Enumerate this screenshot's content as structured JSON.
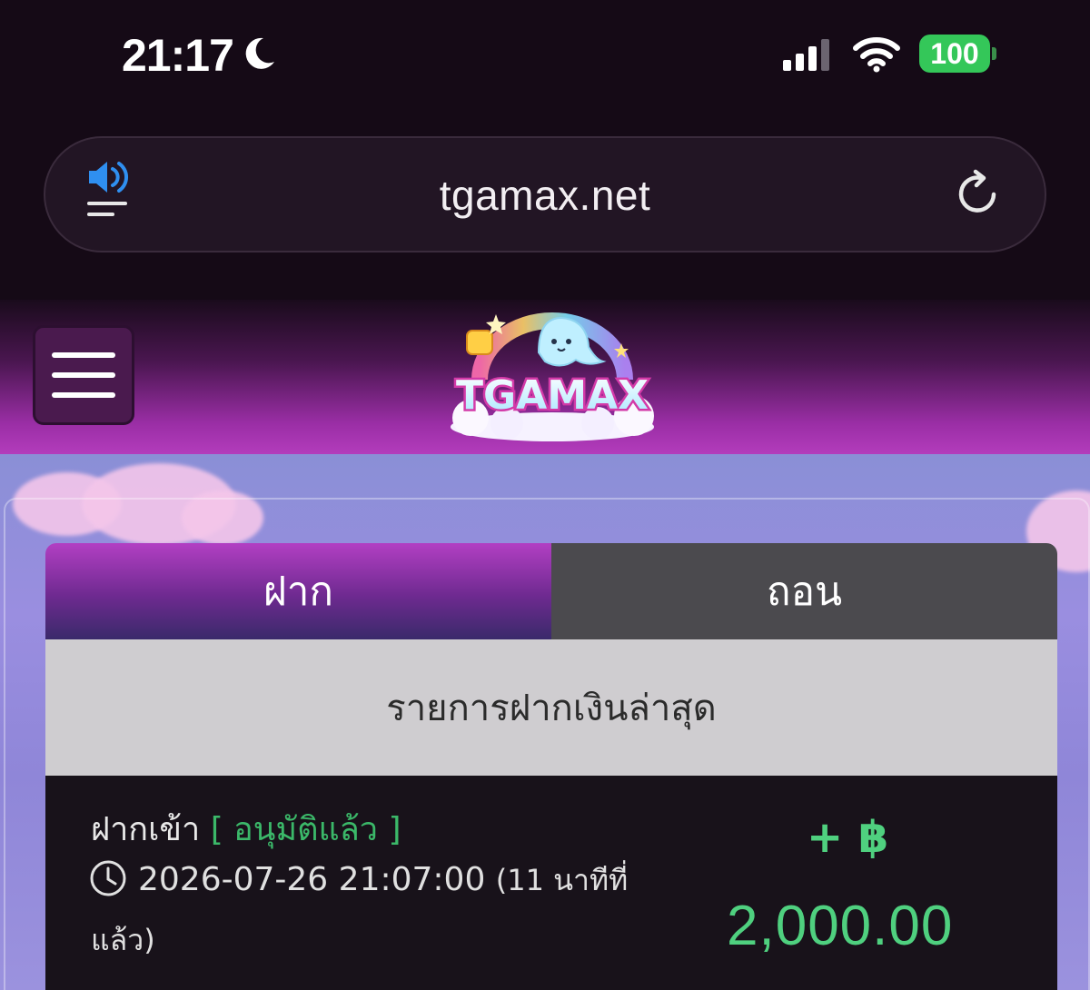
{
  "status_bar": {
    "time": "21:17",
    "battery": "100",
    "icons": [
      "moon-icon",
      "signal-icon",
      "wifi-icon",
      "battery-icon"
    ]
  },
  "browser": {
    "url": "tgamax.net",
    "icons": [
      "speaker-icon",
      "reload-icon"
    ]
  },
  "site": {
    "logo_text": "TGAMAX",
    "menu_icon": "hamburger-menu-icon"
  },
  "tabs": [
    {
      "label": "ฝาก",
      "active": true
    },
    {
      "label": "ถอน",
      "active": false
    }
  ],
  "section": {
    "title": "รายการฝากเงินล่าสุด"
  },
  "transaction": {
    "type": "ฝากเข้า",
    "status": "[ อนุมัติแล้ว ]",
    "date": "2026-07-26 21:07:00",
    "ago_part1": "(11 นาทีที่",
    "ago_part2": "แล้ว)",
    "currency": "+ ฿",
    "amount": "2,000.00"
  },
  "colors": {
    "accent_purple": "#b23fc3",
    "status_green": "#3bb869",
    "amount_green": "#4fd07f",
    "battery_green": "#34c759"
  }
}
